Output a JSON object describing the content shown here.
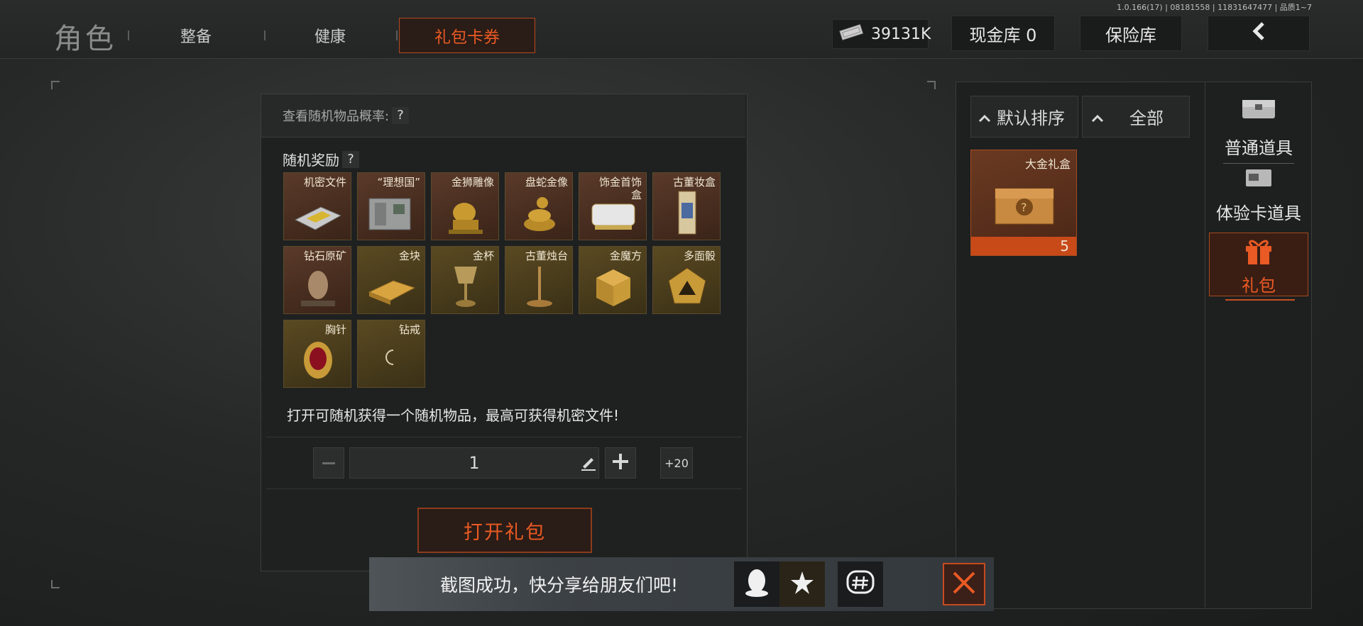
{
  "header": {
    "title": "角色",
    "tabs": [
      "整备",
      "健康",
      "礼包卡券"
    ],
    "active_tab": "礼包卡券",
    "version": "1.0.166(17) | 08181558 | 11831647477 | 品质1~7",
    "money": "39131K",
    "cash_vault": "现金库 0",
    "insurance": "保险库"
  },
  "panel": {
    "prob_label": "查看随机物品概率:",
    "help": "?",
    "rewards_label": "随机奖励",
    "description": "打开可随机获得一个随机物品，最高可获得机密文件!",
    "quantity": "1",
    "plus20": "+20",
    "open_label": "打开礼包",
    "items": [
      {
        "name": "机密文件",
        "tone": "red"
      },
      {
        "name": "“理想国”",
        "tone": "red"
      },
      {
        "name": "金狮雕像",
        "tone": "red"
      },
      {
        "name": "盘蛇金像",
        "tone": "red"
      },
      {
        "name": "饰金首饰盒",
        "tone": "red"
      },
      {
        "name": "古董妆盒",
        "tone": "red"
      },
      {
        "name": "钻石原矿",
        "tone": "red"
      },
      {
        "name": "金块",
        "tone": "gold"
      },
      {
        "name": "金杯",
        "tone": "gold"
      },
      {
        "name": "古董烛台",
        "tone": "gold"
      },
      {
        "name": "金魔方",
        "tone": "gold"
      },
      {
        "name": "多面骰",
        "tone": "gold"
      },
      {
        "name": "胸针",
        "tone": "gold"
      },
      {
        "name": "钻戒",
        "tone": "gold"
      }
    ]
  },
  "inventory": {
    "sort_label": "默认排序",
    "filter_label": "全部",
    "item_name": "大金礼盒",
    "item_count": "5",
    "categories": [
      "普通道具",
      "体验卡道具",
      "礼包"
    ],
    "active_category": "礼包"
  },
  "toast": {
    "message": "截图成功，快分享给朋友们吧!"
  },
  "colors": {
    "accent": "#ea5a24",
    "panel": "#1f2121",
    "gold_tile": "#4a3c1c",
    "red_tile": "#4a2e20"
  }
}
